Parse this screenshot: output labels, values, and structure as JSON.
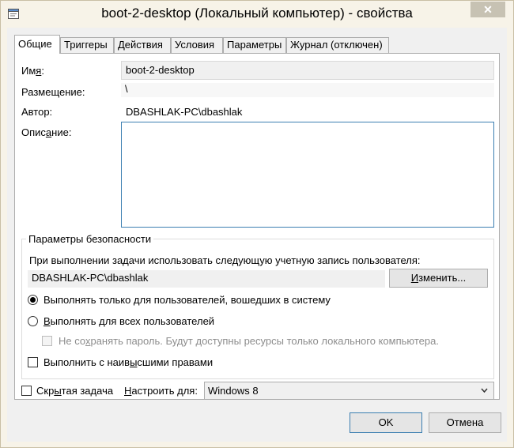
{
  "window": {
    "title": "boot-2-desktop (Локальный компьютер) - свойства",
    "close_glyph": "✕"
  },
  "tabs": [
    {
      "label": "Общие",
      "active": true
    },
    {
      "label": "Триггеры"
    },
    {
      "label": "Действия"
    },
    {
      "label": "Условия"
    },
    {
      "label": "Параметры"
    },
    {
      "label": "Журнал (отключен)"
    }
  ],
  "general": {
    "name_label_pre": "Им",
    "name_label_acc": "я",
    "name_label_post": ":",
    "name_value": "boot-2-desktop",
    "location_label": "Размещение:",
    "location_value": "\\",
    "author_label": "Автор:",
    "author_value": "DBASHLAK-PC\\dbashlak",
    "description_label_pre": "Опис",
    "description_label_acc": "а",
    "description_label_post": "ние:",
    "description_value": ""
  },
  "security": {
    "group_title": "Параметры безопасности",
    "account_prompt": "При выполнении задачи использовать следующую учетную запись пользователя:",
    "account_value": "DBASHLAK-PC\\dbashlak",
    "change_button_pre": "",
    "change_button_acc": "И",
    "change_button_post": "зменить...",
    "radio_logged_on_pre": "Выполнять только для пользователей, вошедших в систему",
    "radio_all_users_pre": "",
    "radio_all_users_acc": "В",
    "radio_all_users_post": "ыполнять для всех пользователей",
    "no_store_password_pre": "Не со",
    "no_store_password_acc": "х",
    "no_store_password_post": "ранять пароль. Будут доступны ресурсы только локального компьютера.",
    "highest_privileges_pre": "Выполнить с наив",
    "highest_privileges_acc": "ы",
    "highest_privileges_post": "сшими правами",
    "selected_radio": "logged_on"
  },
  "bottom": {
    "hidden_pre": "Скр",
    "hidden_acc": "ы",
    "hidden_post": "тая задача",
    "configure_pre": "",
    "configure_acc": "Н",
    "configure_post": "астроить для:",
    "configure_value": "Windows 8"
  },
  "buttons": {
    "ok": "OK",
    "cancel": "Отмена"
  },
  "icons": {
    "app": "task-scheduler-icon",
    "close": "close-icon",
    "dropdown": "chevron-down-icon"
  }
}
